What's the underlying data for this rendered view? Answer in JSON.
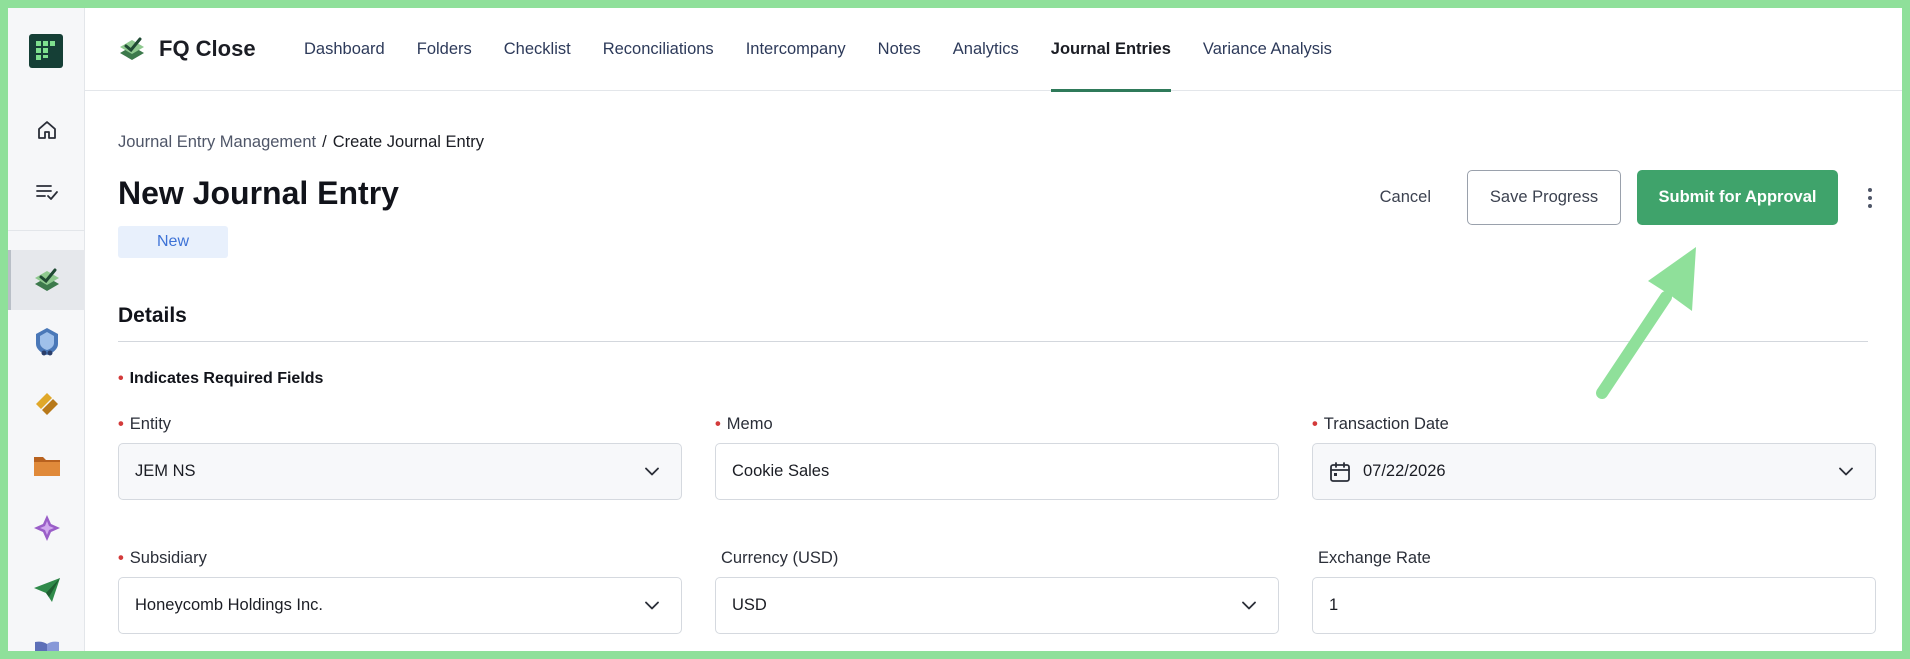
{
  "app": {
    "name": "FQ Close"
  },
  "nav": {
    "items": [
      {
        "label": "Dashboard",
        "active": false
      },
      {
        "label": "Folders",
        "active": false
      },
      {
        "label": "Checklist",
        "active": false
      },
      {
        "label": "Reconciliations",
        "active": false
      },
      {
        "label": "Intercompany",
        "active": false
      },
      {
        "label": "Notes",
        "active": false
      },
      {
        "label": "Analytics",
        "active": false
      },
      {
        "label": "Journal Entries",
        "active": true
      },
      {
        "label": "Variance Analysis",
        "active": false
      }
    ]
  },
  "breadcrumb": {
    "parent": "Journal Entry Management",
    "separator": "/",
    "current": "Create Journal Entry"
  },
  "page": {
    "title": "New Journal Entry",
    "status": "New"
  },
  "actions": {
    "cancel": "Cancel",
    "save": "Save Progress",
    "submit": "Submit for Approval"
  },
  "details": {
    "title": "Details",
    "required_note": "Indicates Required Fields",
    "fields": {
      "entity": {
        "label": "Entity",
        "value": "JEM NS",
        "required": true
      },
      "memo": {
        "label": "Memo",
        "value": "Cookie Sales",
        "required": true
      },
      "transaction_date": {
        "label": "Transaction Date",
        "value": "07/22/2026",
        "required": true
      },
      "subsidiary": {
        "label": "Subsidiary",
        "value": "Honeycomb Holdings Inc.",
        "required": true
      },
      "currency": {
        "label": "Currency (USD)",
        "value": "USD",
        "required": false
      },
      "exchange_rate": {
        "label": "Exchange Rate",
        "value": "1",
        "required": false
      }
    }
  },
  "rail": {
    "icons": [
      "home-icon",
      "tasks-list-icon",
      "fq-close-app-icon",
      "shield-app-icon",
      "link-app-icon",
      "folder-app-icon",
      "sparkle-app-icon",
      "send-app-icon",
      "book-app-icon"
    ]
  },
  "colors": {
    "primary": "#3fa36b",
    "accent_underline": "#2f7a5a",
    "badge_text": "#3d72d6",
    "annotation": "#8fe09a"
  }
}
